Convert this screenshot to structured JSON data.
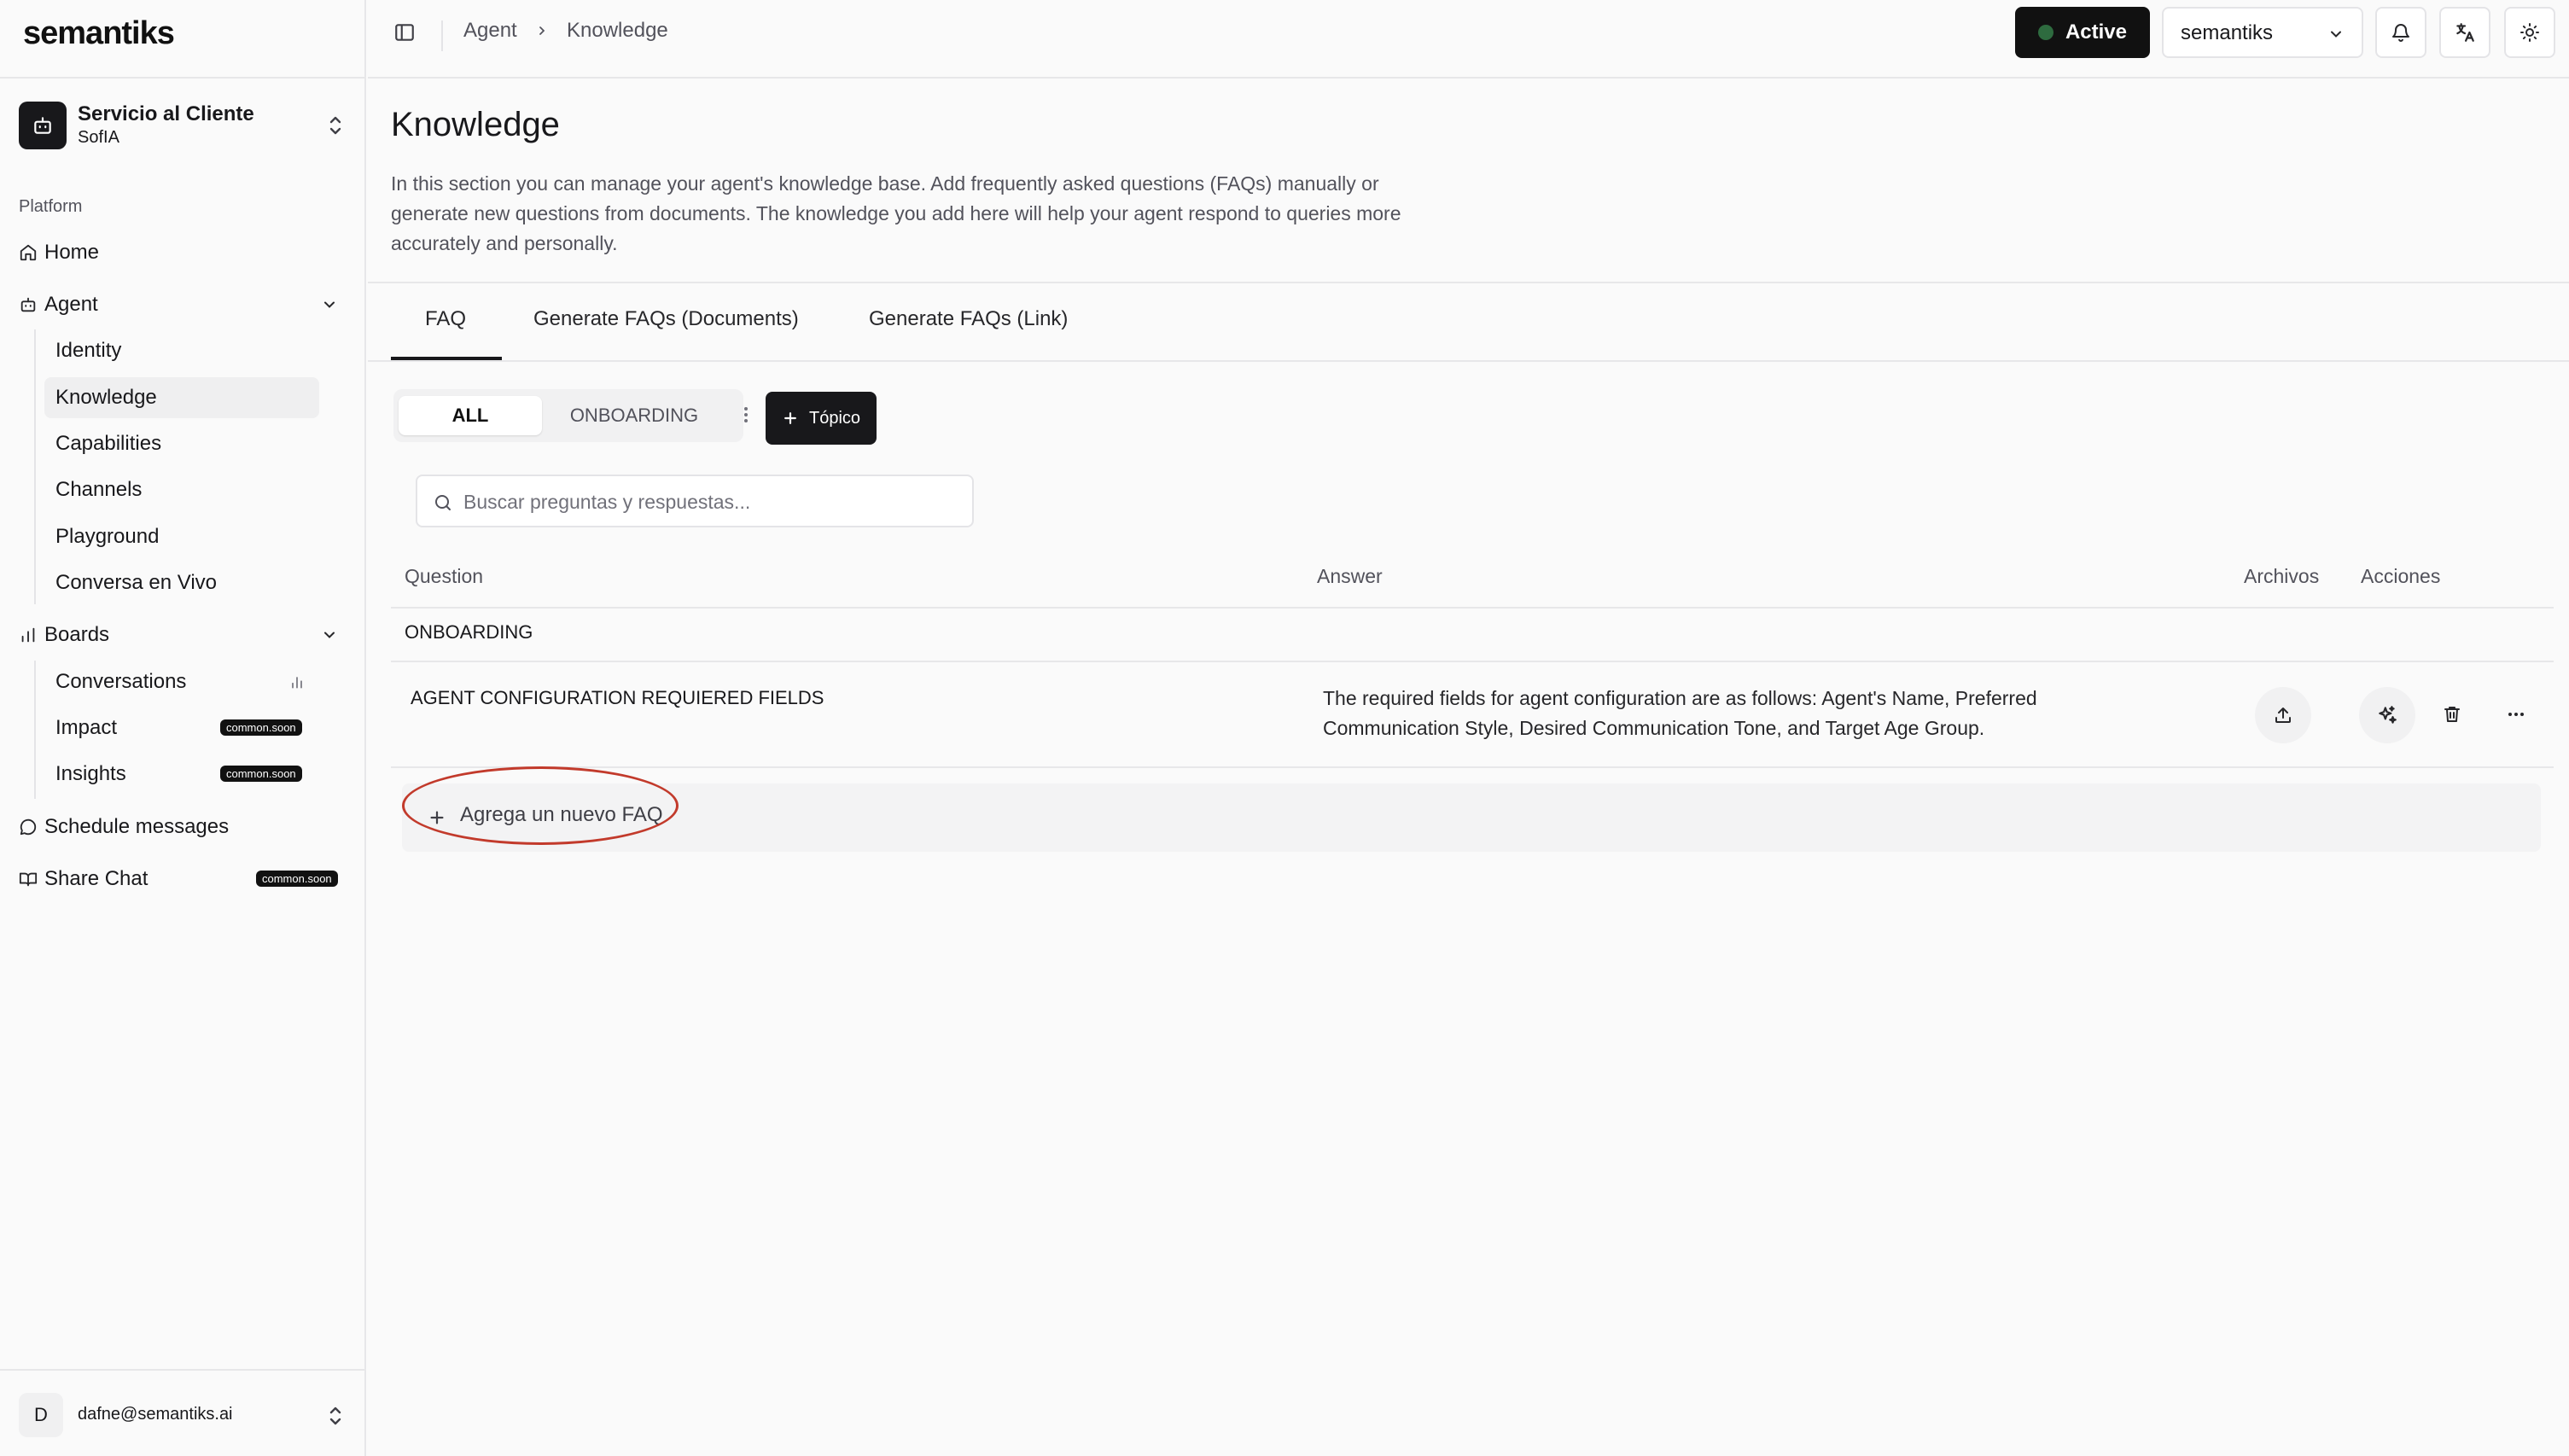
{
  "app": {
    "logo": "semantiks"
  },
  "agent_switcher": {
    "name": "Servicio al Cliente",
    "subtitle": "SofIA"
  },
  "sidebar": {
    "section_label": "Platform",
    "home": "Home",
    "agent": "Agent",
    "agent_items": [
      "Identity",
      "Knowledge",
      "Capabilities",
      "Channels",
      "Playground",
      "Conversa en Vivo"
    ],
    "boards": "Boards",
    "boards_items": [
      "Conversations",
      "Impact",
      "Insights"
    ],
    "soon_badge": "common.soon",
    "schedule": "Schedule messages",
    "share": "Share Chat"
  },
  "user": {
    "initial": "D",
    "email": "dafne@semantiks.ai"
  },
  "header": {
    "breadcrumb": [
      "Agent",
      "Knowledge"
    ],
    "status": "Active",
    "status_color": "#2e6b3f",
    "org": "semantiks"
  },
  "page": {
    "title": "Knowledge",
    "description": "In this section you can manage your agent's knowledge base. Add frequently asked questions (FAQs) manually or generate new questions from documents. The knowledge you add here will help your agent respond to queries more accurately and personally."
  },
  "tabs": [
    "FAQ",
    "Generate FAQs (Documents)",
    "Generate FAQs (Link)"
  ],
  "topics": {
    "items": [
      "ALL",
      "ONBOARDING"
    ],
    "add_label": "Tópico"
  },
  "search": {
    "placeholder": "Buscar preguntas y respuestas...",
    "value": ""
  },
  "table": {
    "headers": {
      "question": "Question",
      "answer": "Answer",
      "files": "Archivos",
      "actions": "Acciones"
    },
    "groups": [
      {
        "name": "ONBOARDING",
        "rows": [
          {
            "question": "AGENT CONFIGURATION REQUIERED FIELDS",
            "answer": "The required fields for agent configuration are as follows: Agent's Name, Preferred Communication Style, Desired Communication Tone, and Target Age Group."
          }
        ]
      }
    ],
    "add_faq": "Agrega un nuevo FAQ"
  },
  "annotation_color": "#c23a2b"
}
